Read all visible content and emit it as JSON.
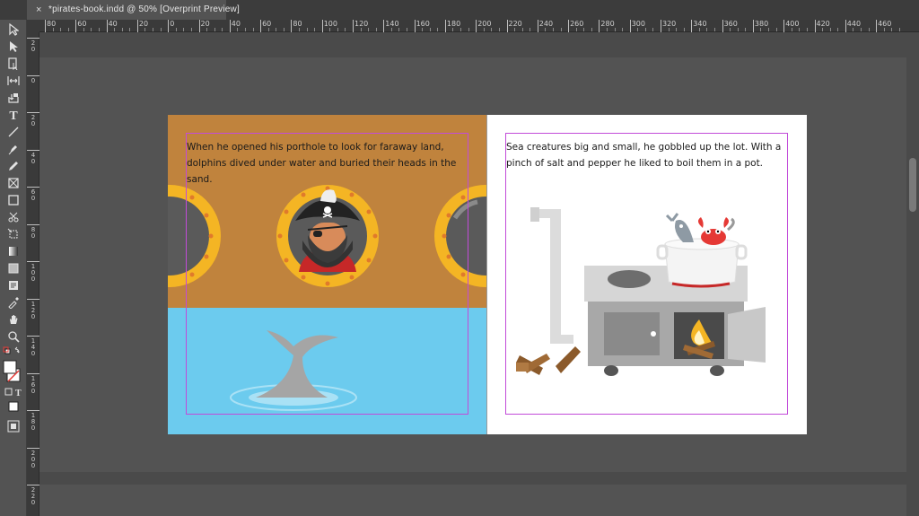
{
  "document": {
    "tab_close": "×",
    "tab_title": "*pirates-book.indd @ 50% [Overprint Preview]"
  },
  "rulers": {
    "horizontal": [
      "80",
      "60",
      "40",
      "20",
      "0",
      "20",
      "40",
      "60",
      "80",
      "100",
      "120",
      "140",
      "160",
      "180",
      "200",
      "220",
      "240",
      "260",
      "280",
      "300",
      "320",
      "340",
      "360",
      "380",
      "400",
      "420",
      "440",
      "460"
    ],
    "vertical": [
      "2\n0",
      "0",
      "2\n0",
      "4\n0",
      "6\n0",
      "8\n0",
      "1\n0\n0",
      "1\n2\n0",
      "1\n4\n0",
      "1\n6\n0",
      "1\n8\n0",
      "2\n0\n0",
      "2\n2\n0"
    ]
  },
  "toolbar": {
    "tools": [
      "selection-tool",
      "direct-selection-tool",
      "page-tool",
      "gap-tool",
      "content-collector-tool",
      "type-tool",
      "line-tool",
      "pen-tool",
      "pencil-tool",
      "rectangle-frame-tool",
      "rectangle-tool",
      "scissors-tool",
      "free-transform-tool",
      "gradient-swatch-tool",
      "gradient-feather-tool",
      "note-tool",
      "eyedropper-tool",
      "hand-tool",
      "zoom-tool"
    ],
    "type_icon_label": "T"
  },
  "spread": {
    "left_page": {
      "text": "When he opened his porthole to look for faraway land, dolphins dived under water and buried their heads in the sand.",
      "sky_color": "#c0833d",
      "sea_color": "#6ccbee"
    },
    "right_page": {
      "text": "Sea creatures big and small, he gobbled up the lot. With a pinch of salt and pepper he liked to boil them in a pot."
    }
  },
  "colors": {
    "margin_guide": "#c24bd9",
    "porthole_rim": "#f4b524",
    "porthole_glass": "#5a5a5a"
  }
}
